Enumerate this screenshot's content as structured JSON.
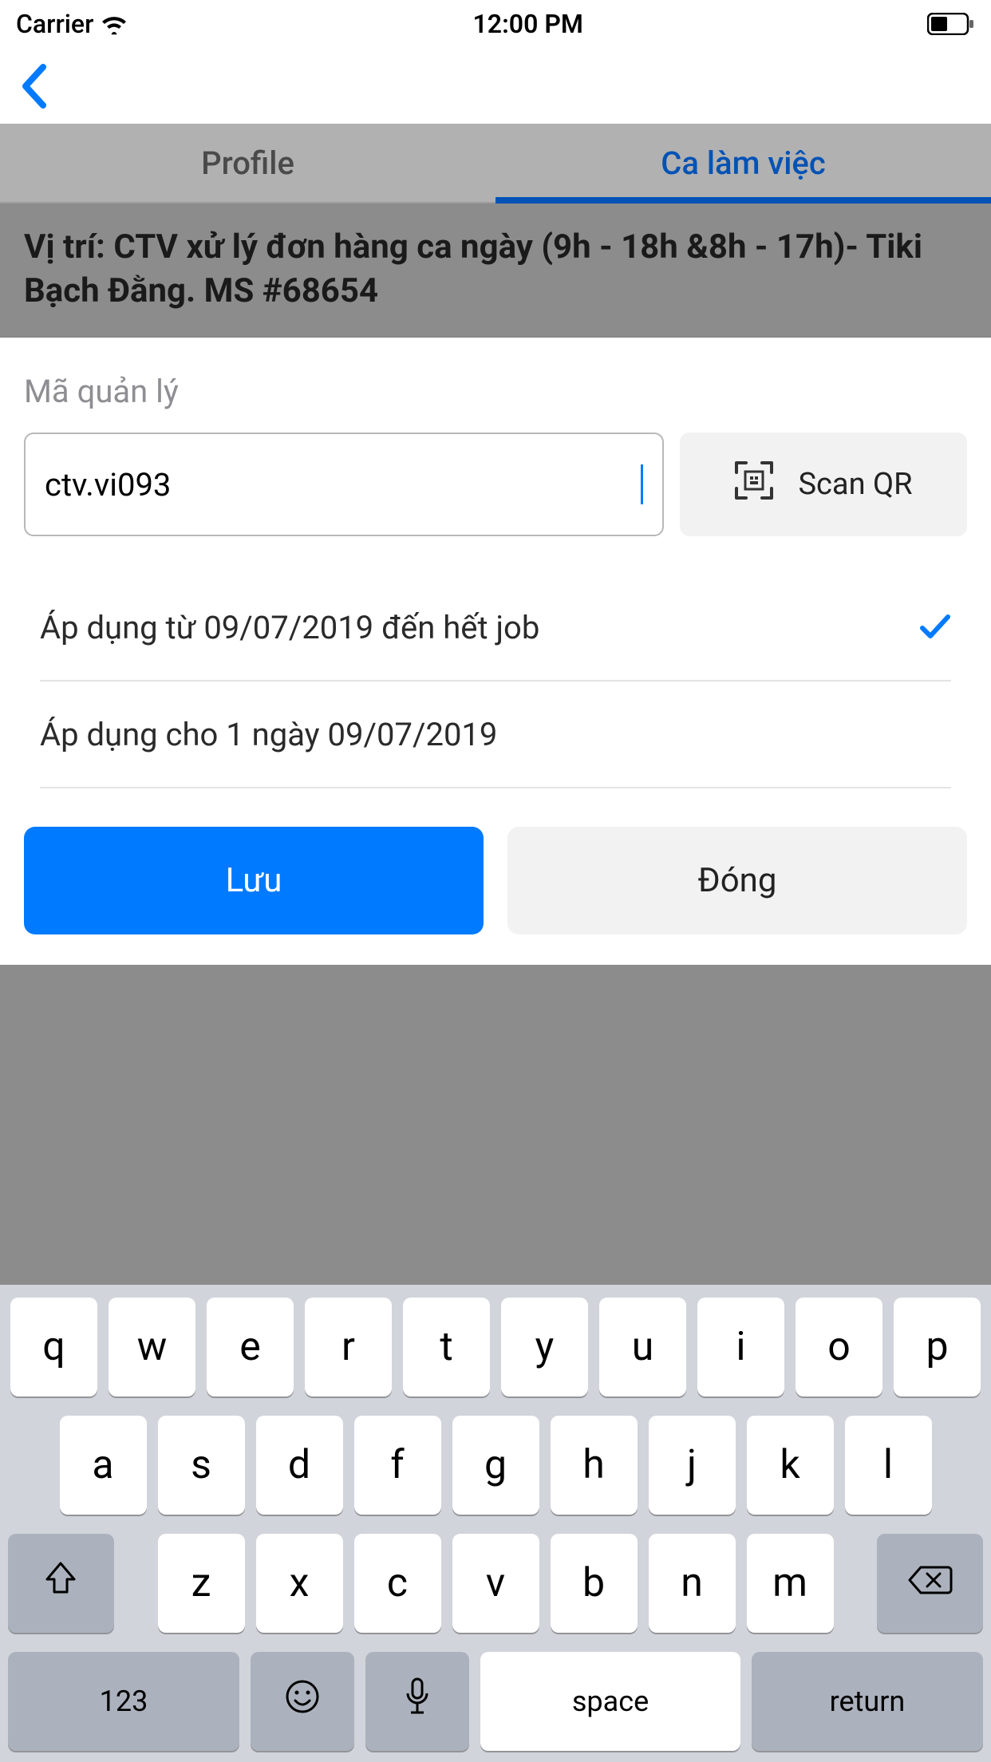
{
  "status_bar": {
    "carrier": "Carrier",
    "time": "12:00 PM"
  },
  "tabs": {
    "profile": "Profile",
    "schedule": "Ca làm việc"
  },
  "banner": {
    "text": "Vị trí: CTV xử lý đơn hàng ca ngày (9h - 18h &8h - 17h)- Tiki Bạch Đằng. MS #68654"
  },
  "form": {
    "code_label": "Mã quản lý",
    "code_value": "ctv.vi093",
    "scan_label": "Scan QR"
  },
  "options": {
    "option1": "Áp dụng từ 09/07/2019 đến hết job",
    "option2": "Áp dụng cho 1 ngày 09/07/2019"
  },
  "actions": {
    "save": "Lưu",
    "close": "Đóng"
  },
  "keyboard": {
    "row1": [
      "q",
      "w",
      "e",
      "r",
      "t",
      "y",
      "u",
      "i",
      "o",
      "p"
    ],
    "row2": [
      "a",
      "s",
      "d",
      "f",
      "g",
      "h",
      "j",
      "k",
      "l"
    ],
    "row3": [
      "z",
      "x",
      "c",
      "v",
      "b",
      "n",
      "m"
    ],
    "numbers": "123",
    "space": "space",
    "return": "return"
  }
}
